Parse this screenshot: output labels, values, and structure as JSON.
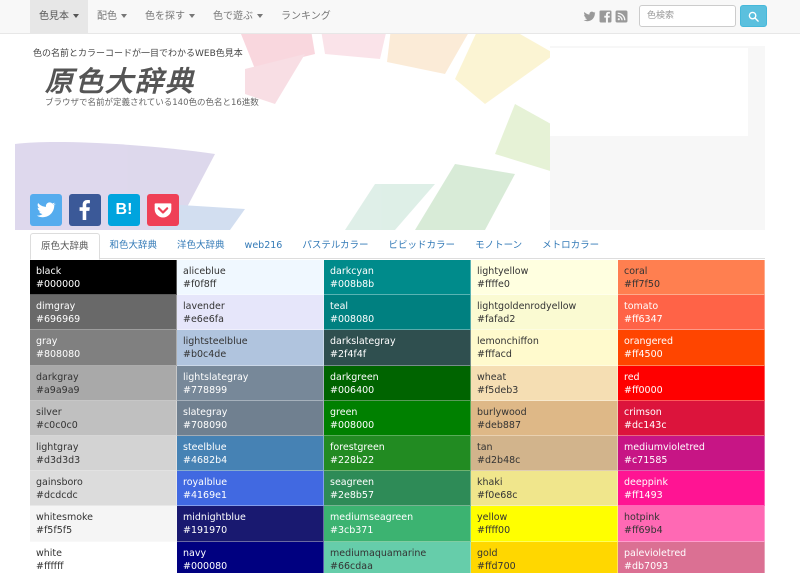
{
  "nav": {
    "items": [
      {
        "label": "色見本",
        "caret": true,
        "active": true
      },
      {
        "label": "配色",
        "caret": true,
        "active": false
      },
      {
        "label": "色を探す",
        "caret": true,
        "active": false
      },
      {
        "label": "色で遊ぶ",
        "caret": true,
        "active": false
      },
      {
        "label": "ランキング",
        "caret": false,
        "active": false
      }
    ],
    "search_placeholder": "色検索"
  },
  "header": {
    "subtitle": "色の名前とカラーコードが一目でわかるWEB色見本",
    "logo": "原色大辞典",
    "tagline": "ブラウザで名前が定義されている140色の色名と16進数"
  },
  "social": [
    {
      "icon": "twitter-icon",
      "color": "#55acee"
    },
    {
      "icon": "facebook-icon",
      "color": "#3b5998"
    },
    {
      "icon": "hatena-bookmark-icon",
      "color": "#00a4de",
      "glyph": "B!"
    },
    {
      "icon": "pocket-icon",
      "color": "#ef4056"
    }
  ],
  "tabs": [
    {
      "label": "原色大辞典",
      "active": true
    },
    {
      "label": "和色大辞典",
      "active": false
    },
    {
      "label": "洋色大辞典",
      "active": false
    },
    {
      "label": "web216",
      "active": false
    },
    {
      "label": "パステルカラー",
      "active": false
    },
    {
      "label": "ビビッドカラー",
      "active": false
    },
    {
      "label": "モノトーン",
      "active": false
    },
    {
      "label": "メトロカラー",
      "active": false
    }
  ],
  "colors": [
    [
      {
        "name": "black",
        "hex": "#000000"
      },
      {
        "name": "dimgray",
        "hex": "#696969"
      },
      {
        "name": "gray",
        "hex": "#808080"
      },
      {
        "name": "darkgray",
        "hex": "#a9a9a9"
      },
      {
        "name": "silver",
        "hex": "#c0c0c0"
      },
      {
        "name": "lightgray",
        "hex": "#d3d3d3"
      },
      {
        "name": "gainsboro",
        "hex": "#dcdcdc"
      },
      {
        "name": "whitesmoke",
        "hex": "#f5f5f5"
      },
      {
        "name": "white",
        "hex": "#ffffff"
      }
    ],
    [
      {
        "name": "aliceblue",
        "hex": "#f0f8ff"
      },
      {
        "name": "lavender",
        "hex": "#e6e6fa"
      },
      {
        "name": "lightsteelblue",
        "hex": "#b0c4de"
      },
      {
        "name": "lightslategray",
        "hex": "#778899"
      },
      {
        "name": "slategray",
        "hex": "#708090"
      },
      {
        "name": "steelblue",
        "hex": "#4682b4"
      },
      {
        "name": "royalblue",
        "hex": "#4169e1"
      },
      {
        "name": "midnightblue",
        "hex": "#191970"
      },
      {
        "name": "navy",
        "hex": "#000080"
      }
    ],
    [
      {
        "name": "darkcyan",
        "hex": "#008b8b"
      },
      {
        "name": "teal",
        "hex": "#008080"
      },
      {
        "name": "darkslategray",
        "hex": "#2f4f4f"
      },
      {
        "name": "darkgreen",
        "hex": "#006400"
      },
      {
        "name": "green",
        "hex": "#008000"
      },
      {
        "name": "forestgreen",
        "hex": "#228b22"
      },
      {
        "name": "seagreen",
        "hex": "#2e8b57"
      },
      {
        "name": "mediumseagreen",
        "hex": "#3cb371"
      },
      {
        "name": "mediumaquamarine",
        "hex": "#66cdaa"
      }
    ],
    [
      {
        "name": "lightyellow",
        "hex": "#ffffe0"
      },
      {
        "name": "lightgoldenrodyellow",
        "hex": "#fafad2"
      },
      {
        "name": "lemonchiffon",
        "hex": "#fffacd"
      },
      {
        "name": "wheat",
        "hex": "#f5deb3"
      },
      {
        "name": "burlywood",
        "hex": "#deb887"
      },
      {
        "name": "tan",
        "hex": "#d2b48c"
      },
      {
        "name": "khaki",
        "hex": "#f0e68c"
      },
      {
        "name": "yellow",
        "hex": "#ffff00"
      },
      {
        "name": "gold",
        "hex": "#ffd700"
      }
    ],
    [
      {
        "name": "coral",
        "hex": "#ff7f50"
      },
      {
        "name": "tomato",
        "hex": "#ff6347"
      },
      {
        "name": "orangered",
        "hex": "#ff4500"
      },
      {
        "name": "red",
        "hex": "#ff0000"
      },
      {
        "name": "crimson",
        "hex": "#dc143c"
      },
      {
        "name": "mediumvioletred",
        "hex": "#c71585"
      },
      {
        "name": "deeppink",
        "hex": "#ff1493"
      },
      {
        "name": "hotpink",
        "hex": "#ff69b4"
      },
      {
        "name": "palevioletred",
        "hex": "#db7093"
      }
    ]
  ]
}
